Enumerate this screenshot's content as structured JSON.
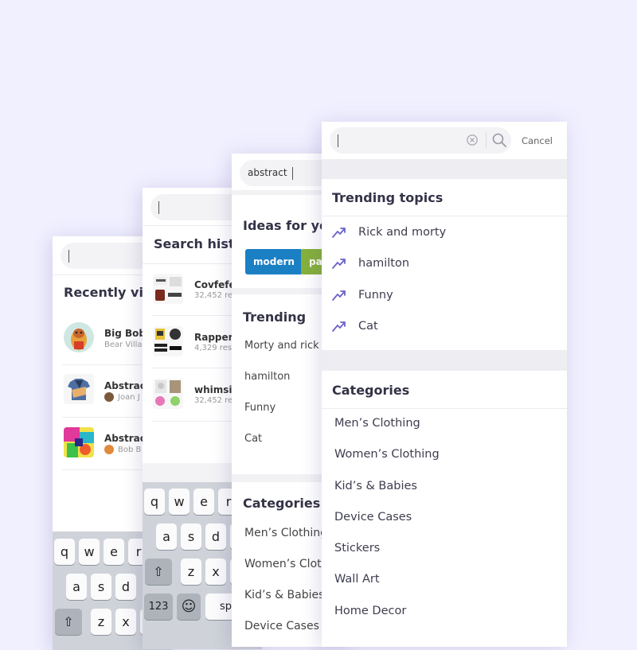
{
  "colors": {
    "background": "#f1f0ff",
    "trending_icon": "#6a62c8",
    "chip_blue": "#1b7fc4",
    "chip_green": "#86b13c"
  },
  "screen1": {
    "section_title": "Recently vie",
    "items": [
      {
        "title": "Big Bob",
        "subtitle": "Bear Villag",
        "thumb_icon": "bear-character-thumbnail"
      },
      {
        "title": "Abstract",
        "subtitle": "Joan J",
        "thumb_icon": "tshirt-thumbnail"
      },
      {
        "title": "Abstract",
        "subtitle": "Bob B",
        "thumb_icon": "abstract-art-thumbnail"
      }
    ],
    "keyboard": {
      "row1": [
        "q",
        "w",
        "e",
        "r"
      ],
      "row2": [
        "a",
        "s",
        "d"
      ],
      "row3": [
        "⇧",
        "z",
        "x",
        "c"
      ]
    }
  },
  "screen2": {
    "section_title": "Search histo",
    "items": [
      {
        "title": "Covfefe",
        "subtitle": "32,452 resu"
      },
      {
        "title": "Rapper s",
        "subtitle": "4,329 resu"
      },
      {
        "title": "whimsic",
        "subtitle": "32,452 res"
      }
    ],
    "keyboard": {
      "row1": [
        "q",
        "w",
        "e",
        "r"
      ],
      "row2": [
        "a",
        "s",
        "d",
        "f"
      ],
      "row3": [
        "⇧",
        "z",
        "x",
        "c"
      ],
      "numbers_key": "123",
      "emoji_key": "☺",
      "space_key": "sp"
    }
  },
  "screen3": {
    "search_value": "abstract",
    "ideas_title": "Ideas for you",
    "chips": [
      "modern",
      "pa"
    ],
    "trending_title": "Trending",
    "trending": [
      "Morty and rick",
      "hamilton",
      "Funny",
      "Cat"
    ],
    "categories_title": "Categories",
    "categories": [
      "Men’s Clothing",
      "Women’s Clothing",
      "Kid’s & Babies",
      "Device Cases"
    ]
  },
  "screen4": {
    "search_placeholder": "",
    "cancel_label": "Cancel",
    "trending_title": "Trending topics",
    "trending": [
      "Rick and morty",
      "hamilton",
      "Funny",
      "Cat"
    ],
    "categories_title": "Categories",
    "categories": [
      "Men’s Clothing",
      "Women’s Clothing",
      "Kid’s & Babies",
      "Device Cases",
      "Stickers",
      "Wall Art",
      "Home Decor"
    ]
  }
}
